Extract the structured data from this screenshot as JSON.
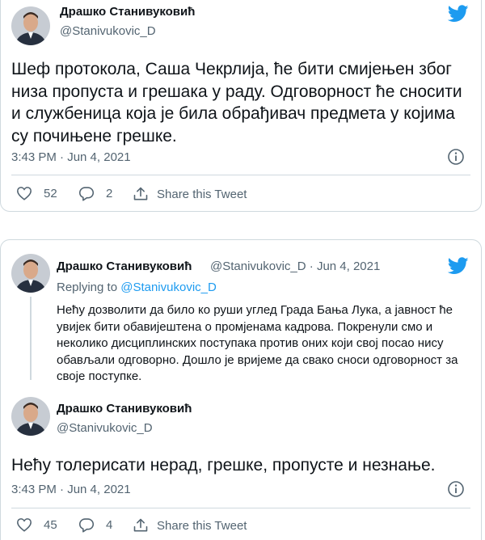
{
  "colors": {
    "twitter_blue": "#1d9bf0",
    "muted": "#536471",
    "text": "#0f1419",
    "border": "#cfd9de"
  },
  "tweet1": {
    "author_name": "Драшко Станивуковић",
    "author_handle": "@Stanivukovic_D",
    "text": "Шеф протокола, Саша Чекрлија, ће бити смијењен због низа пропуста и грешака у раду. Одговорност ће сносити и службеница која је била обрађивач предмета у којима су почињене грешке.",
    "timestamp": "3:43 PM · Jun 4, 2021",
    "likes": "52",
    "replies": "2",
    "share_label": "Share this Tweet",
    "icons": [
      "avatar",
      "twitter-bird-icon",
      "info-icon",
      "heart-icon",
      "reply-icon",
      "share-icon"
    ]
  },
  "tweet2": {
    "parent": {
      "author_name": "Драшко Станивуковић",
      "handle_date": "@Stanivukovic_D · Jun 4, 2021",
      "replying_prefix": "Replying to ",
      "replying_handle": "@Stanivukovic_D",
      "text": "Нећу дозволити да било ко руши углед Града Бања Лука, а јавност ће увијек бити обавијештена о промјенама кадрова. Покренули смо и неколико дисциплинских поступака против оних који свој посао нису обављали одговорно. Дошло је вријеме да свако сноси одговорност за своје поступке."
    },
    "author_name": "Драшко Станивуковић",
    "author_handle": "@Stanivukovic_D",
    "text": "Нећу толерисати нерад, грешке, пропусте и незнање.",
    "timestamp": "3:43 PM · Jun 4, 2021",
    "likes": "45",
    "replies": "4",
    "share_label": "Share this Tweet"
  }
}
